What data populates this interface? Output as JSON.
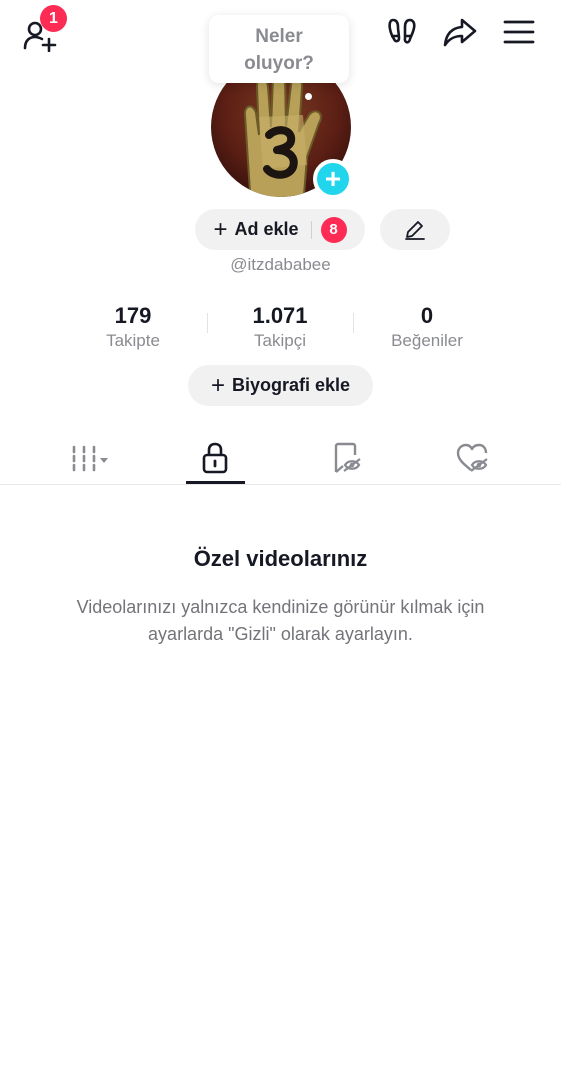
{
  "header": {
    "notification_count": "1",
    "icons": [
      "add-friend-icon",
      "footprints-icon",
      "share-icon",
      "menu-icon"
    ]
  },
  "bubble": {
    "text_line1": "Neler",
    "text_line2": "oluyor?"
  },
  "profile": {
    "add_name_label": "Ad ekle",
    "add_name_badge": "8",
    "username": "@itzdababee"
  },
  "stats": [
    {
      "value": "179",
      "label": "Takipte"
    },
    {
      "value": "1.071",
      "label": "Takipçi"
    },
    {
      "value": "0",
      "label": "Beğeniler"
    }
  ],
  "bio": {
    "add_bio_label": "Biyografi ekle"
  },
  "tabs": [
    {
      "icon": "grid-icon",
      "active": false
    },
    {
      "icon": "lock-icon",
      "active": true
    },
    {
      "icon": "favorites-hidden-icon",
      "active": false
    },
    {
      "icon": "liked-hidden-icon",
      "active": false
    }
  ],
  "empty_state": {
    "title": "Özel videolarınız",
    "description": "Videolarınızı yalnızca kendinize görünür kılmak için ayarlarda \"Gizli\" olarak ayarlayın."
  },
  "colors": {
    "accent": "#fe2c55",
    "avatar_plus": "#20d5ec",
    "muted_text": "#8a8b91"
  }
}
